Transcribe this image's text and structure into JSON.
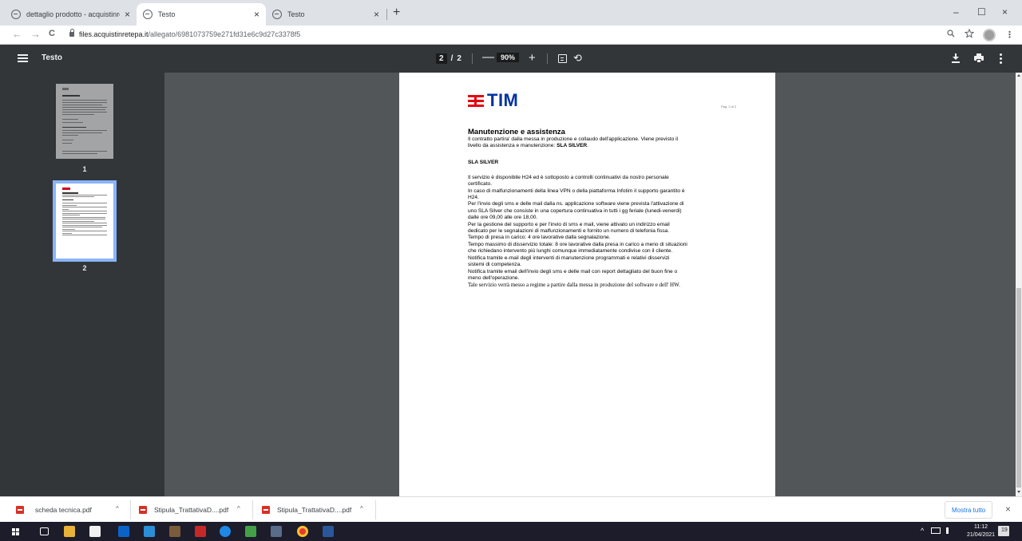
{
  "browser": {
    "tabs": [
      {
        "label": "dettaglio prodotto - acquistinrete",
        "close": "×"
      },
      {
        "label": "Testo",
        "close": "×"
      },
      {
        "label": "Testo",
        "close": "×"
      }
    ],
    "new_tab": "+",
    "window_controls": {
      "minimize": "–",
      "maximize": "☐",
      "close": "×"
    },
    "nav": {
      "back": "←",
      "forward": "→",
      "reload": "C"
    },
    "url_host": "files.acquistinretepa.it",
    "url_path": "/allegato/6981073759e271fd31e6c9d27c3378f5",
    "zoom_icon": "magnifier-icon",
    "star_icon": "star-icon",
    "menu_glyph": "⋮"
  },
  "pdf_toolbar": {
    "title": "Testo",
    "current_page": "2",
    "page_sep": "/",
    "total_pages": "2",
    "zoom_minus": "—",
    "zoom": "90%",
    "zoom_plus": "+",
    "rotate_glyph": "⟲"
  },
  "sidebar": {
    "thumbnails": [
      {
        "page_number": "1"
      },
      {
        "page_number": "2"
      }
    ]
  },
  "document": {
    "logo_text": "TIM",
    "page_label": "Pag. 2 di 2",
    "heading": "Manutenzione e assistenza",
    "intro_1": "Il contratto partira' dalla messa in produzione e collaudo dell'applicazione. Viene previsto il",
    "intro_2_prefix": "livello da assistenza e manutenzione: ",
    "intro_2_bold": "SLA SILVER",
    "intro_2_suffix": ".",
    "subheading": "SLA SILVER",
    "lines": [
      "Il servizio è disponibile H24 ed è sottoposto a controlli continuativi da nostro personale",
      "certificato.",
      "In caso di malfunzionamenti della linea VPN o della piattaforma Infotim il supporto garantito è",
      "H24.",
      "Per l'invio degli sms e delle mail dalla ns. applicazione software viene prevista l'attivazione di",
      "uno SLA Silver che consiste in una copertura continuativa in tutti i gg feriale (lunedi-venerdi)",
      "dalle ore 09,00 alle ore 18,00.",
      "Per la gestione del supporto e per l'invio di sms e mail, viene attivato un indirizzo email",
      "dedicato per le segnalazioni di malfunzionamenti e fornito un numero di telefonia fissa.",
      "Tempo di presa in carico: 4 ore lavorative dalla segnalazione.",
      "Tempo massimo di disservizio totale: 8 ore lavorative dalla presa in carico a meno di situazioni",
      "che richiedano intervento più lunghi comunque immediatamente condivise con il cliente.",
      "Notifica tramite e-mail degli interventi di manutenzione programmati e relativi disservizi",
      "sistemi di competenza.",
      "Notifica tramite email dell'invio degli sms e delle mail con report dettagliato del buon fine o",
      "meno dell'operazione."
    ],
    "closing": "Tale servizio verrà messo a regime a partire dalla messa in produzione del software e dell' HW."
  },
  "downloads": {
    "items": [
      {
        "name": "scheda tecnica.pdf",
        "chevron": "^"
      },
      {
        "name": "Stipula_TrattativaD....pdf",
        "chevron": "^"
      },
      {
        "name": "Stipula_TrattativaD....pdf",
        "chevron": "^"
      }
    ],
    "show_all": "Mostra tutto",
    "close": "×"
  },
  "taskbar": {
    "time": "11:12",
    "date": "21/04/2021",
    "tray_glyph": "^",
    "notification_count": "19"
  },
  "colors": {
    "tim_red": "#e30613",
    "tim_blue": "#0033a0",
    "pdf_toolbar": "#323639",
    "viewer_bg": "#525659",
    "thumb_selected": "#8ab4f8"
  }
}
